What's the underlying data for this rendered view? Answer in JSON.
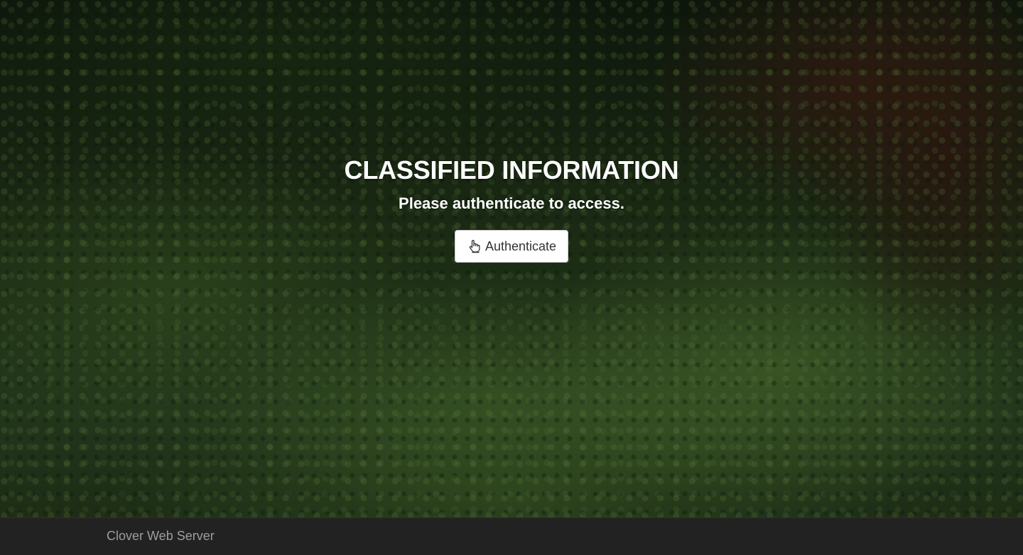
{
  "hero": {
    "title": "CLASSIFIED INFORMATION",
    "subtitle": "Please authenticate to access.",
    "button": {
      "label": "Authenticate",
      "icon": "hand-pointer-icon"
    }
  },
  "footer": {
    "text": "Clover Web Server"
  },
  "colors": {
    "footer_background": "#222222",
    "footer_text": "#9d9d9d",
    "button_background": "#ffffff",
    "heading_text": "#ffffff"
  }
}
